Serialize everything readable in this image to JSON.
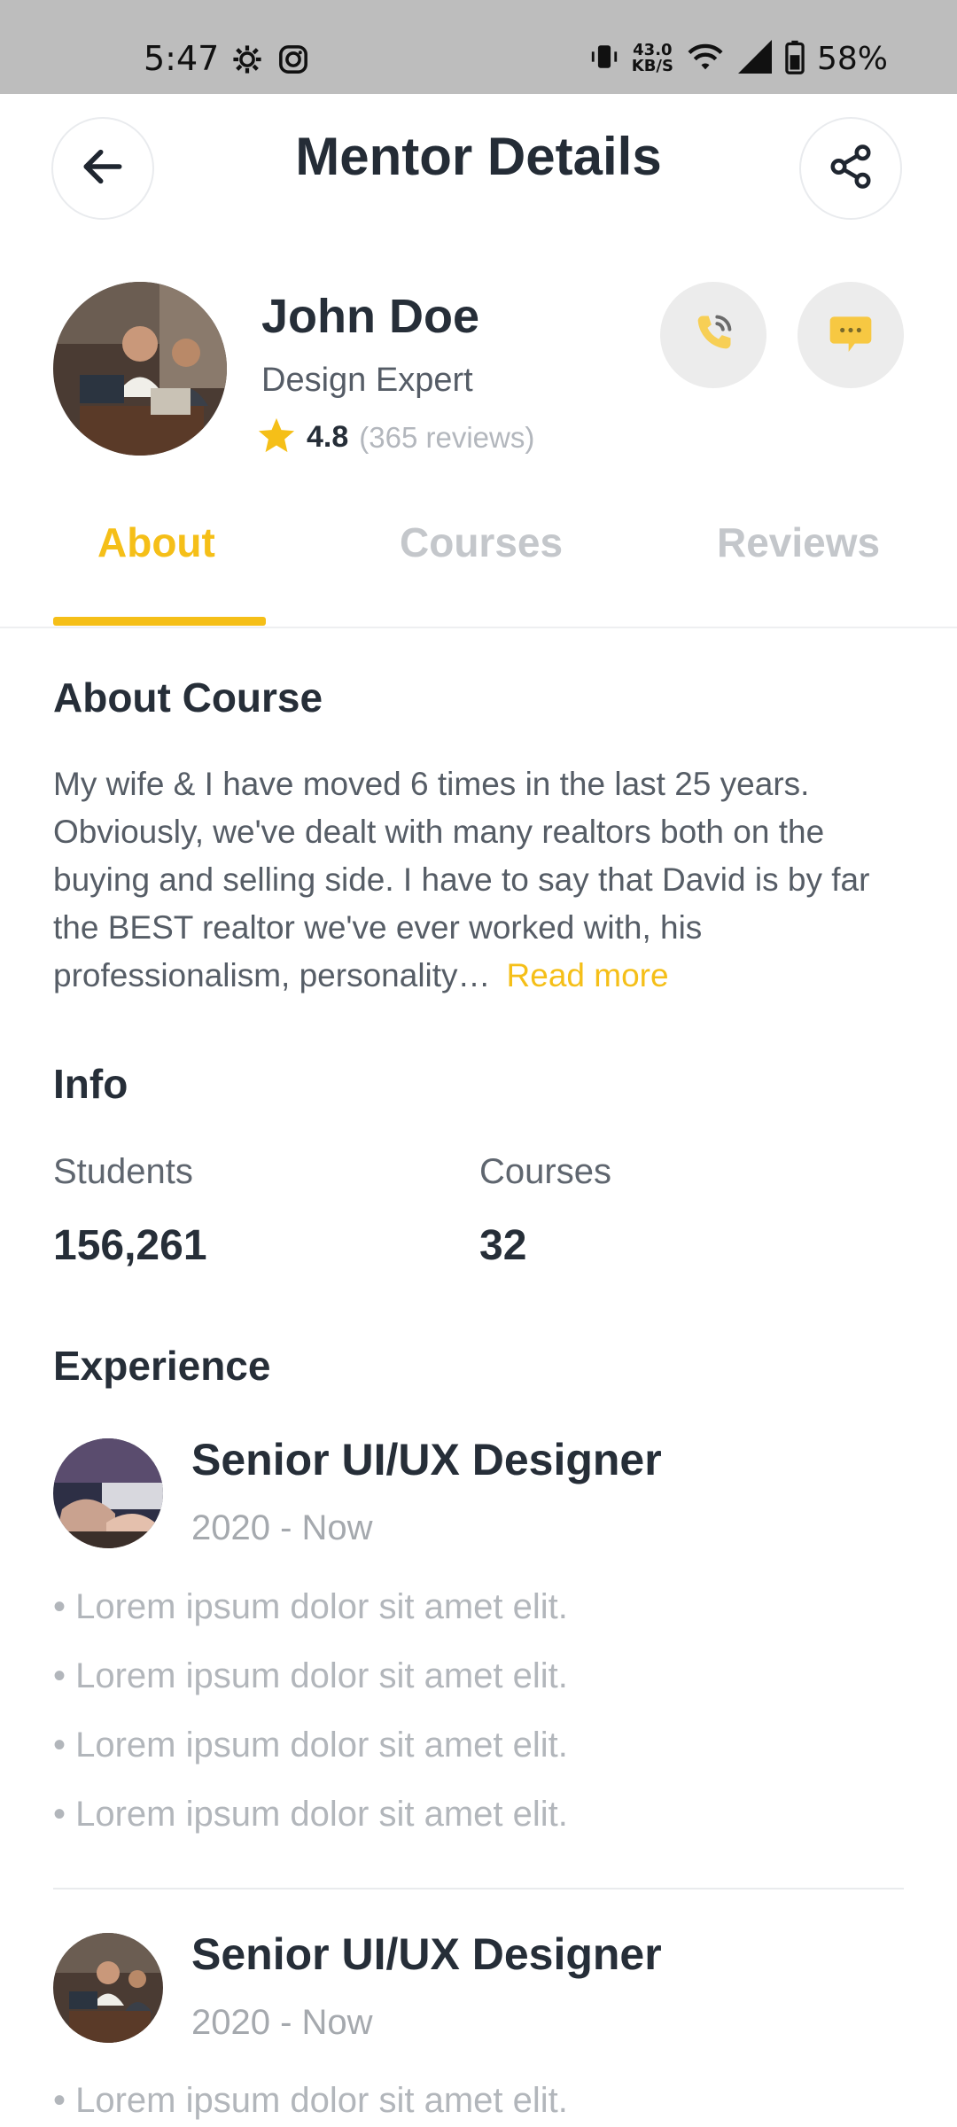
{
  "status_bar": {
    "time": "5:47",
    "network_speed_value": "43.0",
    "network_speed_unit": "KB/S",
    "battery": "58%",
    "icons": [
      "settings-icon",
      "instagram-icon",
      "vibrate-icon",
      "wifi-icon",
      "signal-icon",
      "battery-icon"
    ]
  },
  "header": {
    "title": "Mentor Details",
    "back_icon": "arrow-left-icon",
    "share_icon": "share-icon"
  },
  "mentor": {
    "name": "John Doe",
    "role": "Design Expert",
    "rating": "4.8",
    "reviews": "(365 reviews)",
    "call_icon": "phone-icon",
    "message_icon": "chat-bubble-icon"
  },
  "tabs": [
    {
      "label": "About",
      "active": true
    },
    {
      "label": "Courses",
      "active": false
    },
    {
      "label": "Reviews",
      "active": false
    }
  ],
  "about": {
    "title": "About Course",
    "text": "My wife & I have moved 6 times in the last 25 years. Obviously, we've dealt with many realtors both on the buying and selling side. I have to say that David is by far the BEST realtor we've ever worked with, his professionalism, personality…",
    "read_more": "Read more"
  },
  "info": {
    "title": "Info",
    "students_label": "Students",
    "students_value": "156,261",
    "courses_label": "Courses",
    "courses_value": "32"
  },
  "experience": {
    "title": "Experience",
    "items": [
      {
        "title": "Senior UI/UX Designer",
        "date": "2020 - Now",
        "bullets": [
          "• Lorem ipsum dolor sit amet elit.",
          "• Lorem ipsum dolor sit amet elit.",
          "• Lorem ipsum dolor sit amet elit.",
          "• Lorem ipsum dolor sit amet elit."
        ]
      },
      {
        "title": "Senior UI/UX Designer",
        "date": "2020 - Now",
        "bullets": [
          "• Lorem ipsum dolor sit amet elit."
        ]
      }
    ]
  },
  "colors": {
    "accent": "#f5bf18",
    "text_dark": "#262e38",
    "text_muted": "#b2b6bb",
    "status_bar": "#bdbdbd"
  }
}
